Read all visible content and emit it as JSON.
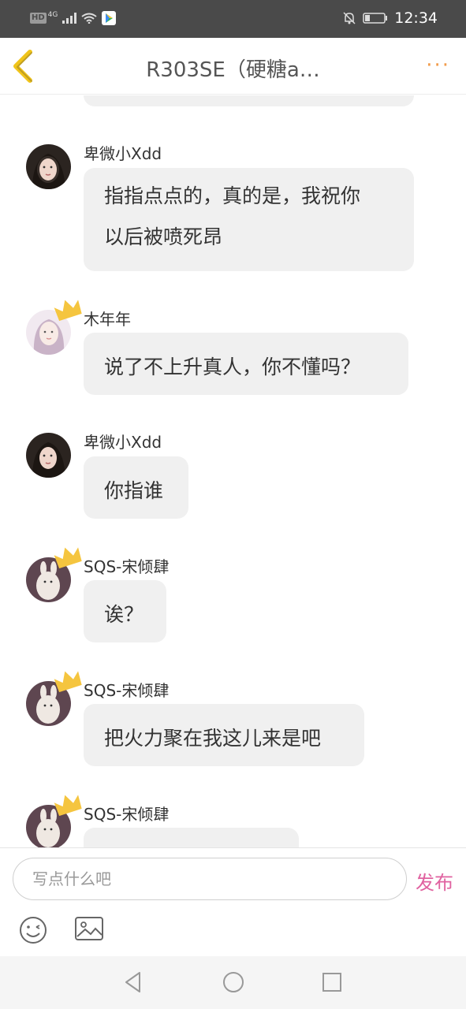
{
  "status_bar": {
    "hd": "HD",
    "network": "4G",
    "time": "12:34"
  },
  "header": {
    "title": "R303SE（硬糖a…",
    "back_icon": "chevron-left-icon",
    "more_label": "···"
  },
  "messages": [
    {
      "name": "卑微小Xdd",
      "text_lines": [
        "指指点点的，真的是，我祝你",
        "以后被喷死昂"
      ],
      "avatar": "dark-hair-girl",
      "crown": false
    },
    {
      "name": "木年年",
      "text_lines": [
        "说了不上升真人，你不懂吗？"
      ],
      "avatar": "light-girl",
      "crown": true
    },
    {
      "name": "卑微小Xdd",
      "text_lines": [
        "你指谁"
      ],
      "avatar": "dark-hair-girl",
      "crown": false
    },
    {
      "name": "SQS-宋倾肆",
      "text_lines": [
        "诶？"
      ],
      "avatar": "plush-bunny",
      "crown": true
    },
    {
      "name": "SQS-宋倾肆",
      "text_lines": [
        "把火力聚在我这儿来是吧"
      ],
      "avatar": "plush-bunny",
      "crown": true
    },
    {
      "name": "SQS-宋倾肆",
      "text_lines": [
        ""
      ],
      "avatar": "plush-bunny",
      "crown": true
    }
  ],
  "input": {
    "placeholder": "写点什么吧",
    "publish_label": "发布"
  },
  "colors": {
    "accent_pink": "#e062a0",
    "more_orange": "#f29b4a",
    "crown_yellow": "#f5c53f",
    "back_yellow": "#f0c419",
    "bubble_bg": "#f0f0f0"
  }
}
